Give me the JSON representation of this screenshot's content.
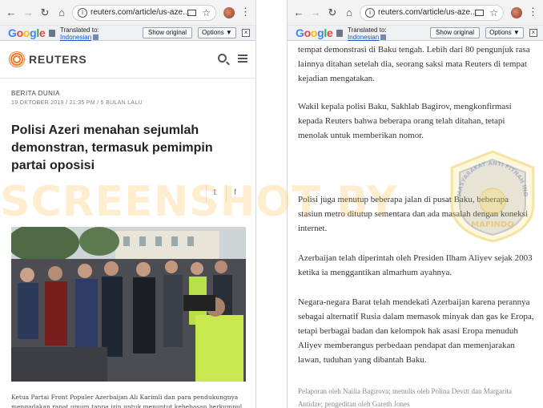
{
  "left_browser": {
    "url": "reuters.com/article/us-aze...",
    "translate": {
      "logo": "Google",
      "label": "Translated to:",
      "language": "Indonesian",
      "show_original": "Show original",
      "options": "Options ▼",
      "close": "×"
    }
  },
  "right_browser": {
    "url": "reuters.com/article/us-aze...",
    "translate": {
      "logo": "Google",
      "label": "Translated to:",
      "language": "Indonesian",
      "show_original": "Show original",
      "options": "Options ▼",
      "close": "×"
    }
  },
  "site": {
    "name": "REUTERS"
  },
  "article": {
    "section": "BERITA DUNIA",
    "date": "19 OKTOBER 2019 / 21:35 PM / 5 BULAN LALU",
    "headline": "Polisi Azeri menahan sejumlah demonstran, termasuk pemimpin partai oposisi",
    "caption": "Ketua Partai Front Populer Azerbaijan Ali Karimli dan para pendukungnya mengadakan rapat umum tanpa izin untuk menuntut kebebasan berkumpul di"
  },
  "article_right": {
    "paragraphs": [
      "tempat demonstrasi di Baku tengah. Lebih dari 80 pengunjuk rasa lainnya ditahan setelah dia, seorang saksi mata Reuters di tempat kejadian mengatakan.",
      "Wakil kepala polisi Baku, Sakhlab Bagirov, mengkonfirmasi kepada Reuters bahwa beberapa orang telah ditahan, tetapi menolak untuk memberikan nomor.",
      "Polisi juga menutup beberapa jalan di pusat Baku, beberapa stasiun metro ditutup sementara dan ada masalah dengan koneksi internet.",
      "Azerbaijan telah diperintah oleh Presiden Ilham Aliyev sejak 2003 ketika ia menggantikan almarhum ayahnya.",
      "Negara-negara Barat telah mendekati Azerbaijan karena perannya sebagai alternatif Rusia dalam memasok minyak dan gas ke Eropa, tetapi berbagai badan dan kelompok hak asasi Eropa menuduh Aliyev memberangus perbedaan pendapat dan memenjarakan lawan, tuduhan yang dibantah Baku."
    ],
    "credit": "Pelaporan oleh Nailia Bagirova; menulis oleh Polina Devitt dan Margarita Antidze; pengeditan oleh Gareth Jones"
  },
  "watermark": {
    "text": "SCREENSHOT BY",
    "stamp": "MASYARAKAT ANTI FITNAH INDONESIA · MAFINDO"
  },
  "colors": {
    "brand": "#f07d28",
    "watermark": "#ffaf28",
    "link": "#1a55c5"
  }
}
